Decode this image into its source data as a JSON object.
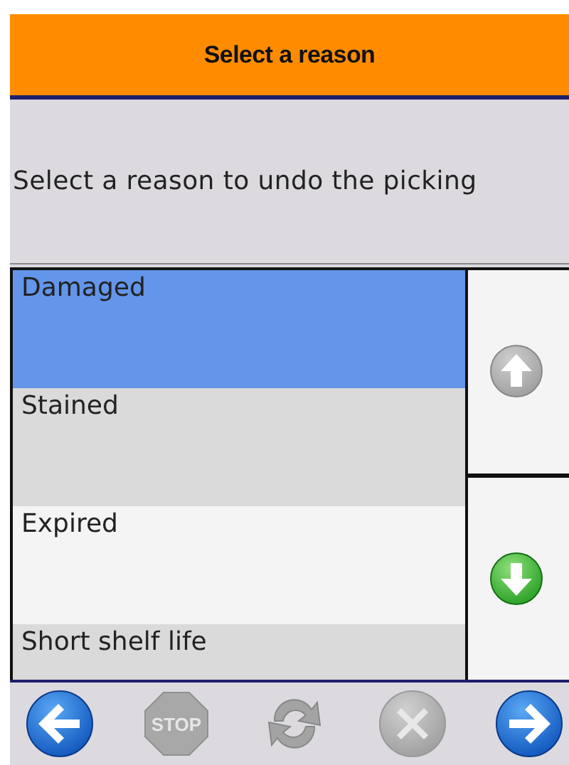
{
  "header": {
    "title": "Select a reason"
  },
  "prompt": "Select a reason to undo the picking",
  "reasons": [
    {
      "label": "Damaged",
      "selected": true
    },
    {
      "label": "Stained",
      "selected": false
    },
    {
      "label": "Expired",
      "selected": false
    },
    {
      "label": "Short shelf life",
      "selected": false
    }
  ],
  "scroll_buttons": [
    {
      "kind": "up",
      "disabled": true
    },
    {
      "kind": "down",
      "disabled": false
    }
  ],
  "toolbar": [
    {
      "kind": "back",
      "disabled": false
    },
    {
      "kind": "stop",
      "label": "STOP",
      "disabled": true
    },
    {
      "kind": "refresh",
      "disabled": true
    },
    {
      "kind": "cancel",
      "disabled": true
    },
    {
      "kind": "forward",
      "disabled": false
    }
  ]
}
